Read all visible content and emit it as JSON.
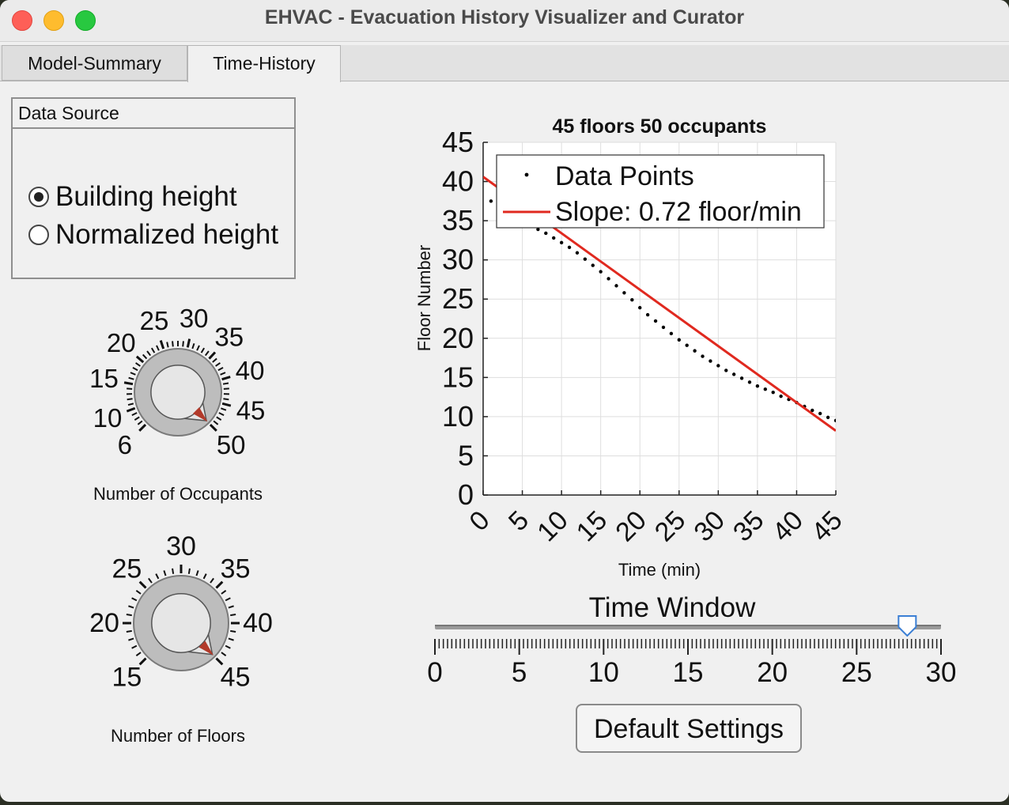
{
  "window": {
    "title": "EHVAC - Evacuation History Visualizer and Curator"
  },
  "tabs": [
    {
      "label": "Model-Summary",
      "active": false
    },
    {
      "label": "Time-History",
      "active": true
    }
  ],
  "data_source": {
    "title": "Data Source",
    "options": [
      {
        "label": "Building height",
        "selected": true
      },
      {
        "label": "Normalized height",
        "selected": false
      }
    ]
  },
  "occupants_knob": {
    "label": "Number of Occupants",
    "min": 6,
    "max": 50,
    "value": 50,
    "major_ticks": [
      6,
      10,
      15,
      20,
      25,
      30,
      35,
      40,
      45,
      50
    ]
  },
  "floors_knob": {
    "label": "Number of Floors",
    "min": 15,
    "max": 45,
    "value": 45,
    "major_ticks": [
      15,
      20,
      25,
      30,
      35,
      40,
      45
    ]
  },
  "chart_data": {
    "type": "line",
    "title": "45 floors 50 occupants",
    "xlabel": "Time (min)",
    "ylabel": "Floor Number",
    "xlim": [
      0,
      45
    ],
    "ylim": [
      0,
      45
    ],
    "xticks": [
      0,
      5,
      10,
      15,
      20,
      25,
      30,
      35,
      40,
      45
    ],
    "yticks": [
      0,
      5,
      10,
      15,
      20,
      25,
      30,
      35,
      40,
      45
    ],
    "grid": true,
    "legend_position": "top",
    "series": [
      {
        "name": "Data Points",
        "style": "dots",
        "color": "#000000",
        "x": [
          1,
          2,
          3,
          4,
          5,
          6,
          7,
          8,
          9,
          10,
          11,
          12,
          13,
          14,
          15,
          16,
          17,
          18,
          19,
          20,
          21,
          22,
          23,
          24,
          25,
          26,
          27,
          28,
          29,
          30,
          31,
          32,
          33,
          34,
          35,
          36,
          37,
          38,
          39,
          40,
          41,
          42,
          43,
          44,
          45
        ],
        "y": [
          37.5,
          36.9,
          36.3,
          35.7,
          35.1,
          34.5,
          33.9,
          33.4,
          32.8,
          32.2,
          31.6,
          30.9,
          30.1,
          29.3,
          28.5,
          27.6,
          26.7,
          25.8,
          24.9,
          23.9,
          23.0,
          22.2,
          21.4,
          20.6,
          19.8,
          19.1,
          18.4,
          17.7,
          17.1,
          16.5,
          15.9,
          15.4,
          14.9,
          14.4,
          13.9,
          13.5,
          13.1,
          12.6,
          12.2,
          11.8,
          11.3,
          10.8,
          10.4,
          9.9,
          9.5
        ]
      },
      {
        "name": "Slope: 0.72 floor/min",
        "style": "line",
        "color": "#e0291f",
        "x": [
          0,
          45
        ],
        "y": [
          40.6,
          8.2
        ]
      }
    ]
  },
  "time_window": {
    "label": "Time Window",
    "min": 0,
    "max": 30,
    "value": 28,
    "tick_labels": [
      0,
      5,
      10,
      15,
      20,
      25,
      30
    ]
  },
  "buttons": {
    "default_settings": "Default Settings"
  },
  "colors": {
    "accent_red": "#e0291f",
    "slider_thumb": "#3b7fd4",
    "knob_pointer": "#b23a2a"
  }
}
